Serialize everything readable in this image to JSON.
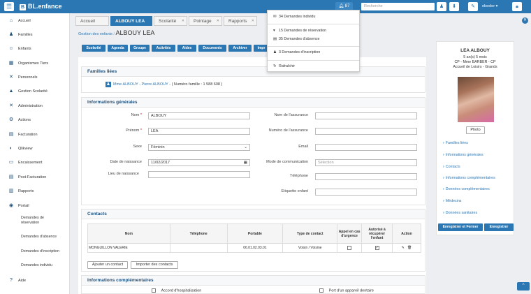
{
  "topbar": {
    "brand": "BL.enfance",
    "notif_count": "87",
    "search_placeholder": "Recherche",
    "username": "ebesler"
  },
  "sidebar": {
    "items": [
      {
        "label": "Accueil",
        "icon": "home-icon",
        "glyph": "⌂"
      },
      {
        "label": "Familles",
        "icon": "users-icon",
        "glyph": "♟"
      },
      {
        "label": "Enfants",
        "icon": "child-icon",
        "glyph": "☺"
      },
      {
        "label": "Organismes Tiers",
        "icon": "building-icon",
        "glyph": "▦"
      },
      {
        "label": "Personnels",
        "icon": "wrench-icon",
        "glyph": "✕"
      },
      {
        "label": "Gestion Scolarité",
        "icon": "graduation-icon",
        "glyph": "▲"
      },
      {
        "label": "Administration",
        "icon": "tools-icon",
        "glyph": "✕"
      },
      {
        "label": "Actions",
        "icon": "cog-icon",
        "glyph": "⚙"
      },
      {
        "label": "Facturation",
        "icon": "invoice-icon",
        "glyph": "▤"
      },
      {
        "label": "Qlikview",
        "icon": "chart-icon",
        "glyph": "◐"
      },
      {
        "label": "Encaissement",
        "icon": "money-icon",
        "glyph": "▭"
      },
      {
        "label": "Post-Facturation",
        "icon": "list-icon",
        "glyph": "▤"
      },
      {
        "label": "Rapports",
        "icon": "report-icon",
        "glyph": "▥"
      },
      {
        "label": "Portail",
        "icon": "globe-icon",
        "glyph": "◉"
      }
    ],
    "subitems": [
      {
        "line1": "Demandes de",
        "line2": "réservation"
      },
      {
        "line1": "Demandes d'absence",
        "line2": ""
      },
      {
        "line1": "Demandes d'inscription",
        "line2": ""
      },
      {
        "line1": "Demandes individu",
        "line2": ""
      }
    ],
    "help": "Aide"
  },
  "tabs": [
    {
      "label": "Accueil"
    },
    {
      "label": "ALBOUY LEA"
    },
    {
      "label": "Scolarité"
    },
    {
      "label": "Pointage"
    },
    {
      "label": "Rapports"
    }
  ],
  "breadcrumb": {
    "parent": "Gestion des enfants",
    "sep": "/",
    "current": "ALBOUY LEA"
  },
  "subnav": [
    "Scolarité",
    "Agenda",
    "Groupe",
    "Activités",
    "Aides",
    "Documents",
    "Archiver",
    "Impr"
  ],
  "familles": {
    "title": "Familles liées",
    "family_link": "Mme ALBOUY - Pierre ALBOUY",
    "family_num": "- ( Numéro famille : 1 588 608 )"
  },
  "info": {
    "title": "Informations générales",
    "nom_label": "Nom",
    "nom": "ALBOUY",
    "prenom_label": "Prénom",
    "prenom": "LEA",
    "sexe_label": "Sexe",
    "sexe": "Féminin",
    "ddn_label": "Date de naissance",
    "ddn": "11/02/2017",
    "lieu_label": "Lieu de naissance",
    "lieu": "",
    "assurance_label": "Nom de l'assurance",
    "num_assurance_label": "Numéro de l'assurance",
    "email_label": "Email",
    "mode_label": "Mode de communication",
    "mode_placeholder": "Sélection",
    "tel_label": "Téléphone",
    "etiquette_label": "Etiquette enfant"
  },
  "contacts": {
    "title": "Contacts",
    "headers": [
      "Nom",
      "Téléphone",
      "Portable",
      "Type de contact",
      "Appel en cas d'urgence",
      "Autorisé à récupérer l'enfant",
      "Action"
    ],
    "rows": [
      {
        "nom": "MONGUILLON VALERIE",
        "tel": "",
        "portable": "06.01.02.03.01",
        "type": "Voisin / Voisine"
      }
    ],
    "add_btn": "Ajouter un contact",
    "import_btn": "Importer des contacts"
  },
  "complementaires": {
    "title": "Informations complémentaires",
    "opt1": "Accord d'hospitalisation",
    "opt2": "Port d'un appareil dentaire"
  },
  "profile": {
    "name": "LEA ALBOUY",
    "age": "5 an(s) 5 mois",
    "class": "CP - Mme BARBER - CP",
    "center": "Accueil de Loisirs - Grands",
    "photo_btn": "Photo",
    "links": [
      "Familles liées",
      "Informations générales",
      "Contacts",
      "Informations complémentaires",
      "Données complémentaires",
      "Médecins",
      "Données sanitaires"
    ],
    "save_close": "Enregistrer et Fermer",
    "save": "Enregistrer"
  },
  "dropdown": {
    "items": [
      {
        "label": "34 Demandes individu",
        "icon": "envelope-icon",
        "glyph": "✉"
      },
      {
        "label": "15 Demandes de réservation",
        "icon": "calendar-icon",
        "glyph": "▾"
      },
      {
        "label": "35 Demandes d'absence",
        "icon": "calendar-x-icon",
        "glyph": "▤"
      },
      {
        "label": "3 Demandes d'inscription",
        "icon": "user-icon",
        "glyph": "♟"
      },
      {
        "label": "Rafraîchir",
        "icon": "refresh-icon",
        "glyph": "↻"
      }
    ]
  },
  "colors": {
    "primary": "#2b77b4",
    "title": "#1e4f7a"
  }
}
